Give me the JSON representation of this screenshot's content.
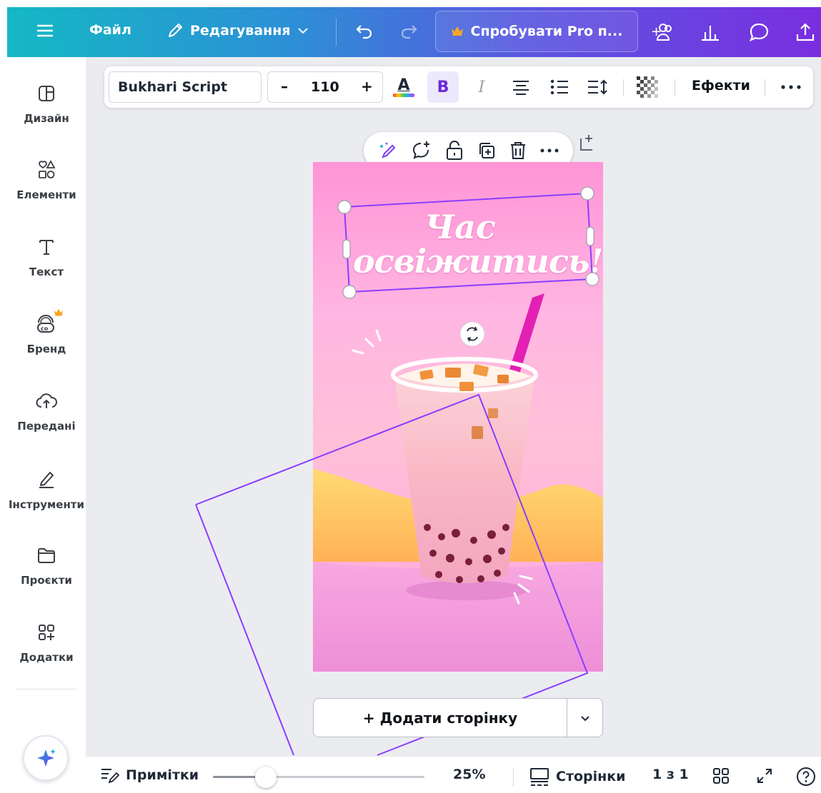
{
  "topbar": {
    "file_label": "Файл",
    "edit_label": "Редагування",
    "pro_label": "Спробувати Pro п...",
    "icons": [
      "menu-icon",
      "pencil-icon",
      "chevron-down-icon",
      "undo-icon",
      "redo-icon",
      "crown-icon",
      "share-people-icon",
      "analytics-icon",
      "comment-icon",
      "upload-icon"
    ]
  },
  "sidebar": {
    "items": [
      {
        "label": "Дизайн",
        "icon": "design-icon"
      },
      {
        "label": "Елементи",
        "icon": "elements-icon"
      },
      {
        "label": "Текст",
        "icon": "text-icon"
      },
      {
        "label": "Бренд",
        "icon": "brand-icon"
      },
      {
        "label": "Передані",
        "icon": "uploads-icon"
      },
      {
        "label": "Інструменти",
        "icon": "tools-icon"
      },
      {
        "label": "Проєкти",
        "icon": "projects-icon"
      },
      {
        "label": "Додатки",
        "icon": "apps-icon"
      }
    ]
  },
  "text_toolbar": {
    "font": "Bukhari Script",
    "size": "110",
    "size_minus": "–",
    "size_plus": "+",
    "color_letter": "A",
    "bold_letter": "B",
    "italic_letter": "I",
    "effects_label": "Ефекти"
  },
  "design": {
    "headline_line1": "Час",
    "headline_line2": "освіжитись!"
  },
  "add_page_label": "+ Додати сторінку",
  "bottombar": {
    "notes_label": "Примітки",
    "zoom": "25%",
    "pages_label": "Сторінки",
    "page_counter": "1 з 1",
    "zoom_fraction": 0.25
  },
  "colors": {
    "accent": "#8b3dff",
    "topbar_start": "#14b8c4",
    "topbar_end": "#7a2ee0",
    "crown": "#f5a623"
  }
}
